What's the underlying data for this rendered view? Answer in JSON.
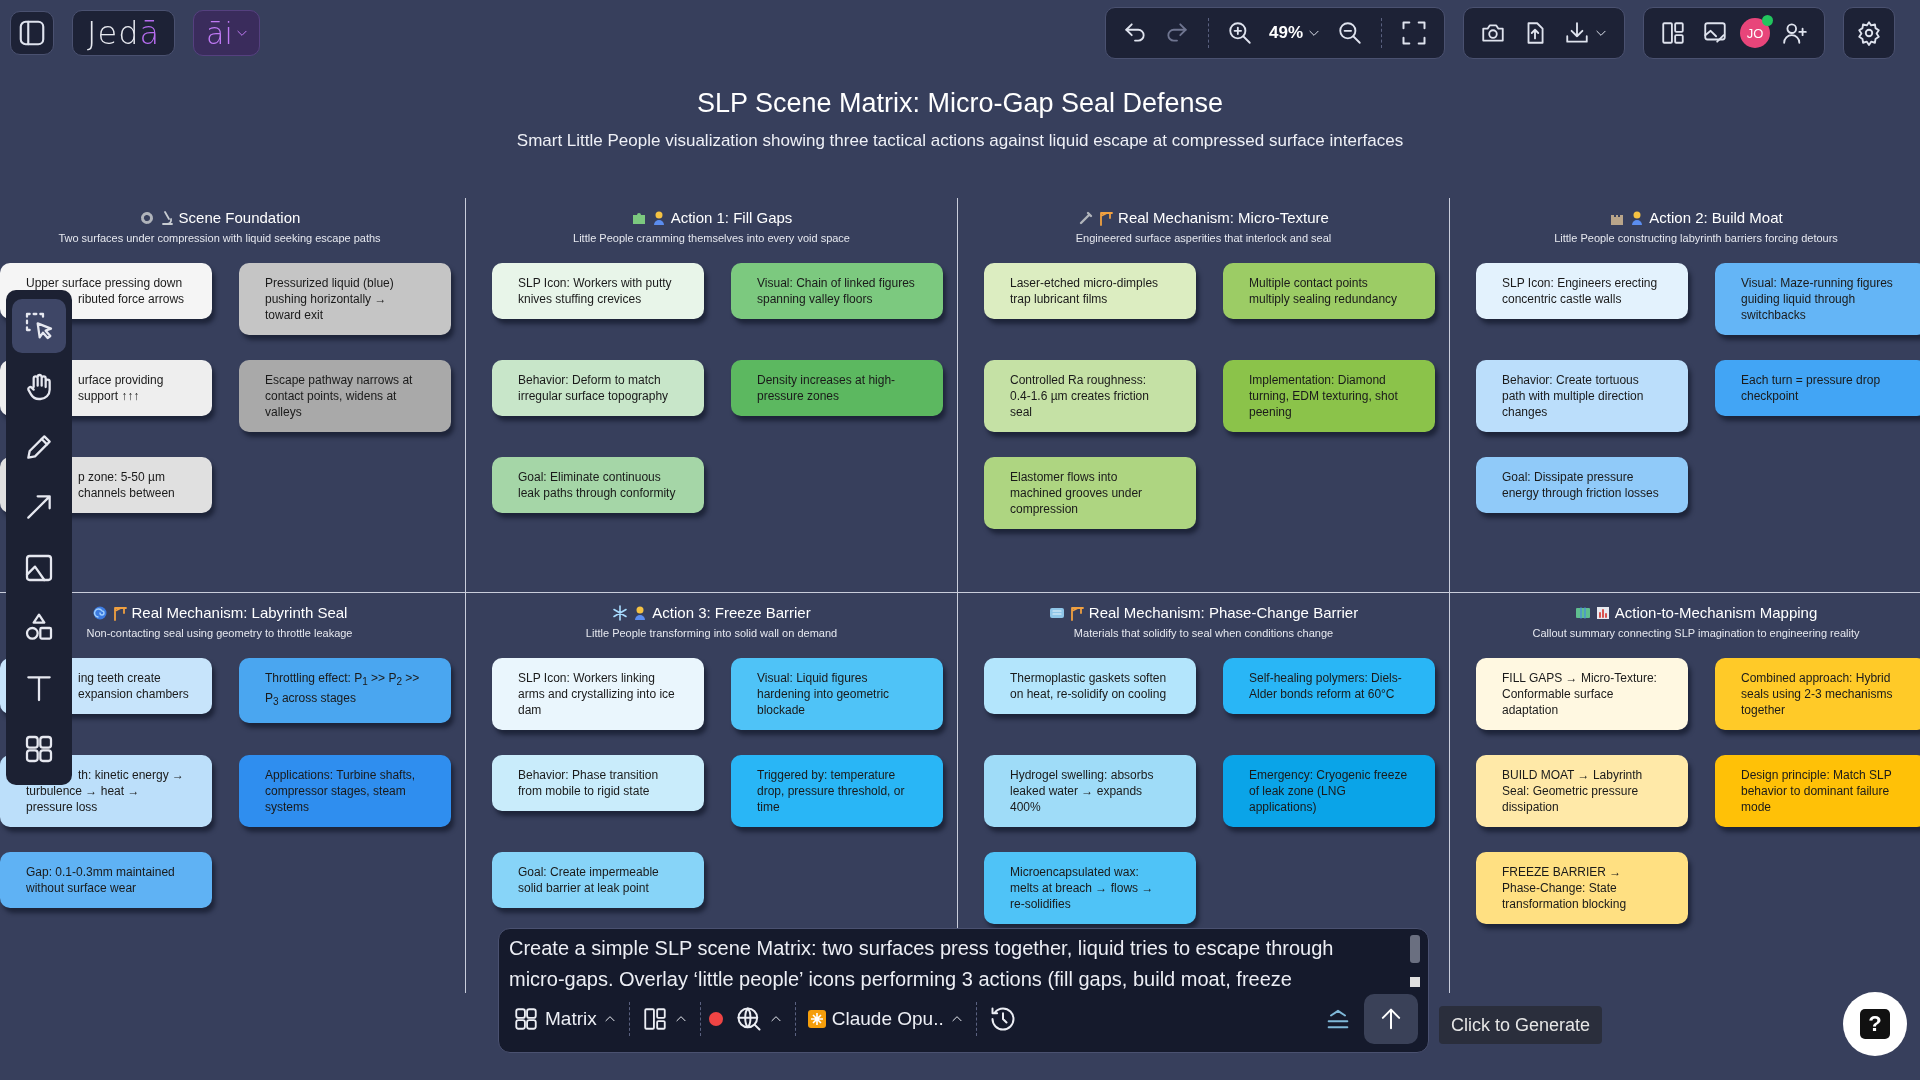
{
  "topbar": {
    "logo": {
      "text": "Jed",
      "accent": "ā"
    },
    "ai_label": "āi",
    "zoom": "49%",
    "avatar": "JO"
  },
  "tools": [
    {
      "kind": "select",
      "selected": true
    },
    {
      "kind": "hand",
      "selected": false
    },
    {
      "kind": "pencil",
      "selected": false
    },
    {
      "kind": "arrow",
      "selected": false
    },
    {
      "kind": "image",
      "selected": false
    },
    {
      "kind": "shapes",
      "selected": false
    },
    {
      "kind": "text",
      "selected": false
    },
    {
      "kind": "components",
      "selected": false
    }
  ],
  "title": "SLP Scene Matrix: Micro-Gap Seal Defense",
  "subtitle": "Smart Little People visualization showing three tactical actions against liquid escape at compressed surface interfaces",
  "cells": [
    {
      "title": "Scene Foundation",
      "subtitle": "Two surfaces under compression with liquid seeking escape paths",
      "cards": [
        {
          "lines": [
            {
              "text": "Upper surface pressing down",
              "covered": false
            },
            {
              "text": "ributed force arrows",
              "covered": true
            }
          ],
          "color": "#f5f5f5"
        },
        {
          "text": "Pressurized liquid (blue) pushing horizontally → toward exit",
          "color": "#c5c5c5"
        },
        {
          "lines": [
            {
              "text": "urface providing",
              "covered": true
            },
            {
              "text": "support ↑↑↑",
              "covered": true
            }
          ],
          "color": "#eeeeee"
        },
        {
          "text": "Escape pathway narrows at contact points, widens at valleys",
          "color": "#a9a9a9"
        },
        {
          "lines": [
            {
              "text": "p zone: 5-50 µm",
              "covered": true
            },
            {
              "text": "channels between",
              "covered": true
            }
          ],
          "color": "#e0e0e0"
        }
      ]
    },
    {
      "title": "Action 1: Fill Gaps",
      "subtitle": "Little People cramming themselves into every void space",
      "cards": [
        {
          "text": "SLP Icon: Workers with putty knives stuffing crevices",
          "color": "#e8f5e9"
        },
        {
          "text": "Visual: Chain of linked figures spanning valley floors",
          "color": "#7cc97f"
        },
        {
          "text": "Behavior: Deform to match irregular surface topography",
          "color": "#c8e6c9"
        },
        {
          "text": "Density increases at high-pressure zones",
          "color": "#5cb860"
        },
        {
          "text": "Goal: Eliminate continuous leak paths through conformity",
          "color": "#a5d6a7"
        }
      ]
    },
    {
      "title": "Real Mechanism: Micro-Texture",
      "subtitle": "Engineered surface asperities that interlock and seal",
      "cards": [
        {
          "text": "Laser-etched micro-dimples trap lubricant films",
          "color": "#dcedc1"
        },
        {
          "text": "Multiple contact points multiply sealing redundancy",
          "color": "#9ccc65"
        },
        {
          "text": "Controlled Ra roughness: 0.4-1.6 µm creates friction seal",
          "color": "#c5e1a5"
        },
        {
          "text": "Implementation: Diamond turning, EDM texturing, shot peening",
          "color": "#8bc34a"
        },
        {
          "text": "Elastomer flows into machined grooves under compression",
          "color": "#aed581"
        }
      ]
    },
    {
      "title": "Action 2: Build Moat",
      "subtitle": "Little People constructing labyrinth barriers forcing detours",
      "cards": [
        {
          "text": "SLP Icon: Engineers erecting concentric castle walls",
          "color": "#e3f2fd"
        },
        {
          "text": "Visual: Maze-running figures guiding liquid through switchbacks",
          "color": "#64b5f6"
        },
        {
          "text": "Behavior: Create tortuous path with multiple direction changes",
          "color": "#bbdefb"
        },
        {
          "text": "Each turn = pressure drop checkpoint",
          "color": "#42a5f5"
        },
        {
          "text": "Goal: Dissipate pressure energy through friction losses",
          "color": "#90caf9"
        }
      ]
    },
    {
      "title": "Real Mechanism: Labyrinth Seal",
      "subtitle": "Non-contacting seal using geometry to throttle leakage",
      "cards": [
        {
          "lines": [
            {
              "text": "ing teeth create",
              "covered": true
            },
            {
              "text": "expansion chambers",
              "covered": true
            }
          ],
          "color": "#c7e4fb"
        },
        {
          "text": "Throttling effect: P$_{1}$ >> P$_{2}$ >> P$_{3}$ across stages",
          "color": "#4aa6f0"
        },
        {
          "lines": [
            {
              "text": "th: kinetic energy →",
              "covered": true
            },
            {
              "text": "turbulence → heat →",
              "covered": false
            },
            {
              "text": "pressure loss",
              "covered": false
            }
          ],
          "color": "#bcdffa"
        },
        {
          "text": "Applications: Turbine shafts, compressor stages, steam systems",
          "color": "#2f8eef"
        },
        {
          "text": "Gap: 0.1-0.3mm maintained without surface wear",
          "color": "#5fb2f4"
        }
      ]
    },
    {
      "title": "Action 3: Freeze Barrier",
      "subtitle": "Little People transforming into solid wall on demand",
      "cards": [
        {
          "text": "SLP Icon: Workers linking arms and crystallizing into ice dam",
          "color": "#eaf6fd"
        },
        {
          "text": "Visual: Liquid figures hardening into geometric blockade",
          "color": "#4fc3f7"
        },
        {
          "text": "Behavior: Phase transition from mobile to rigid state",
          "color": "#c9ecfb"
        },
        {
          "text": "Triggered by: temperature drop, pressure threshold, or time",
          "color": "#29b6f6"
        },
        {
          "text": "Goal: Create impermeable solid barrier at leak point",
          "color": "#87d4f8"
        }
      ]
    },
    {
      "title": "Real Mechanism: Phase-Change Barrier",
      "subtitle": "Materials that solidify to seal when conditions change",
      "cards": [
        {
          "text": "Thermoplastic gaskets soften on heat, re-solidify on cooling",
          "color": "#b3e5fc"
        },
        {
          "text": "Self-healing polymers: Diels-Alder bonds reform at 60°C",
          "color": "#29b6f6"
        },
        {
          "text": "Hydrogel swelling: absorbs leaked water → expands 400%",
          "color": "#9fdcf8"
        },
        {
          "text": "Emergency: Cryogenic freeze of leak zone (LNG applications)",
          "color": "#0aa4e8"
        },
        {
          "text": "Microencapsulated wax: melts at breach → flows → re-solidifies",
          "color": "#4fc3f7"
        }
      ]
    },
    {
      "title": "Action-to-Mechanism Mapping",
      "subtitle": "Callout summary connecting SLP imagination to engineering reality",
      "cards": [
        {
          "text": "FILL GAPS → Micro-Texture: Conformable surface adaptation",
          "color": "#fff8e1"
        },
        {
          "text": "Combined approach: Hybrid seals using 2-3 mechanisms together",
          "color": "#ffca28"
        },
        {
          "text": "BUILD MOAT → Labyrinth Seal: Geometric pressure dissipation",
          "color": "#ffe9a8"
        },
        {
          "text": "Design principle: Match SLP behavior to dominant failure mode",
          "color": "#ffc107"
        },
        {
          "text": "FREEZE BARRIER → Phase-Change: State transformation blocking",
          "color": "#ffe082"
        }
      ]
    }
  ],
  "prompt": {
    "lines": [
      "Create a simple SLP scene Matrix: two surfaces press together, liquid tries to escape through",
      "micro-gaps. Overlay ‘little people’ icons performing 3 actions (fill gaps, build moat, freeze"
    ],
    "mode": "Matrix",
    "model": "Claude Opu.."
  },
  "tooltip": "Click to Generate",
  "help_glyph": "?"
}
